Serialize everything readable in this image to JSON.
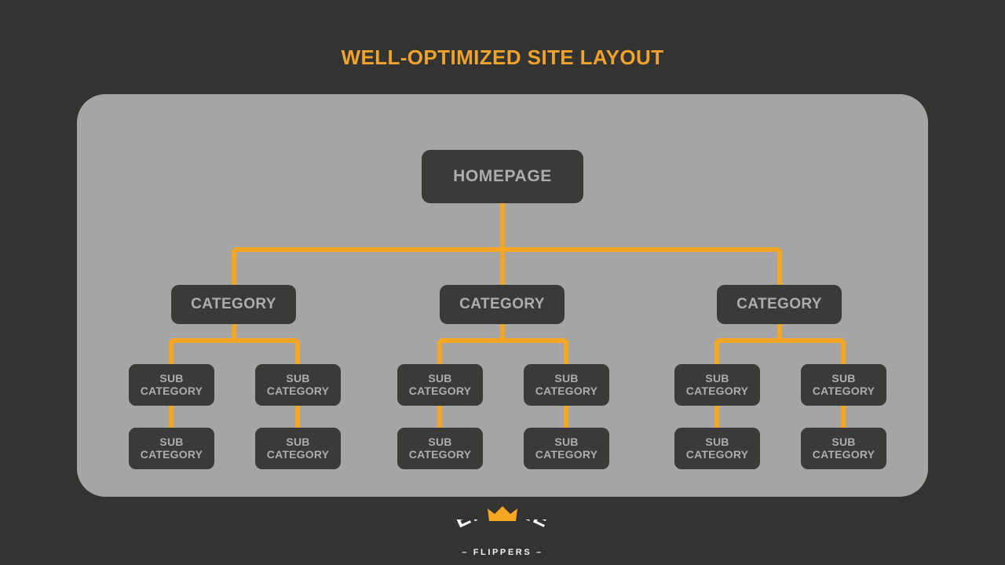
{
  "page": {
    "title": "WELL-OPTIMIZED SITE LAYOUT",
    "background_color": "#333331",
    "panel_color": "#A5A5A5",
    "accent_color": "#F5A623",
    "node_fill_color": "#3A3A38",
    "node_text_color": "#ADADAD"
  },
  "diagram": {
    "type": "site-hierarchy-tree",
    "root": {
      "label": "HOMEPAGE"
    },
    "categories": [
      {
        "label": "CATEGORY",
        "subcategories": [
          {
            "line_1": "SUB",
            "line_2": "CATEGORY",
            "child": {
              "line_1": "SUB",
              "line_2": "CATEGORY"
            }
          },
          {
            "line_1": "SUB",
            "line_2": "CATEGORY",
            "child": {
              "line_1": "SUB",
              "line_2": "CATEGORY"
            }
          }
        ]
      },
      {
        "label": "CATEGORY",
        "subcategories": [
          {
            "line_1": "SUB",
            "line_2": "CATEGORY",
            "child": {
              "line_1": "SUB",
              "line_2": "CATEGORY"
            }
          },
          {
            "line_1": "SUB",
            "line_2": "CATEGORY",
            "child": {
              "line_1": "SUB",
              "line_2": "CATEGORY"
            }
          }
        ]
      },
      {
        "label": "CATEGORY",
        "subcategories": [
          {
            "line_1": "SUB",
            "line_2": "CATEGORY",
            "child": {
              "line_1": "SUB",
              "line_2": "CATEGORY"
            }
          },
          {
            "line_1": "SUB",
            "line_2": "CATEGORY",
            "child": {
              "line_1": "SUB",
              "line_2": "CATEGORY"
            }
          }
        ]
      }
    ]
  },
  "footer": {
    "logo": {
      "brand": "EMPIRE",
      "sub_brand": "FLIPPERS",
      "sub_brand_display": "–  FLIPPERS  –",
      "crown_icon": "crown-icon",
      "crown_color": "#F5A623",
      "text_color": "#F2F2F2"
    }
  }
}
